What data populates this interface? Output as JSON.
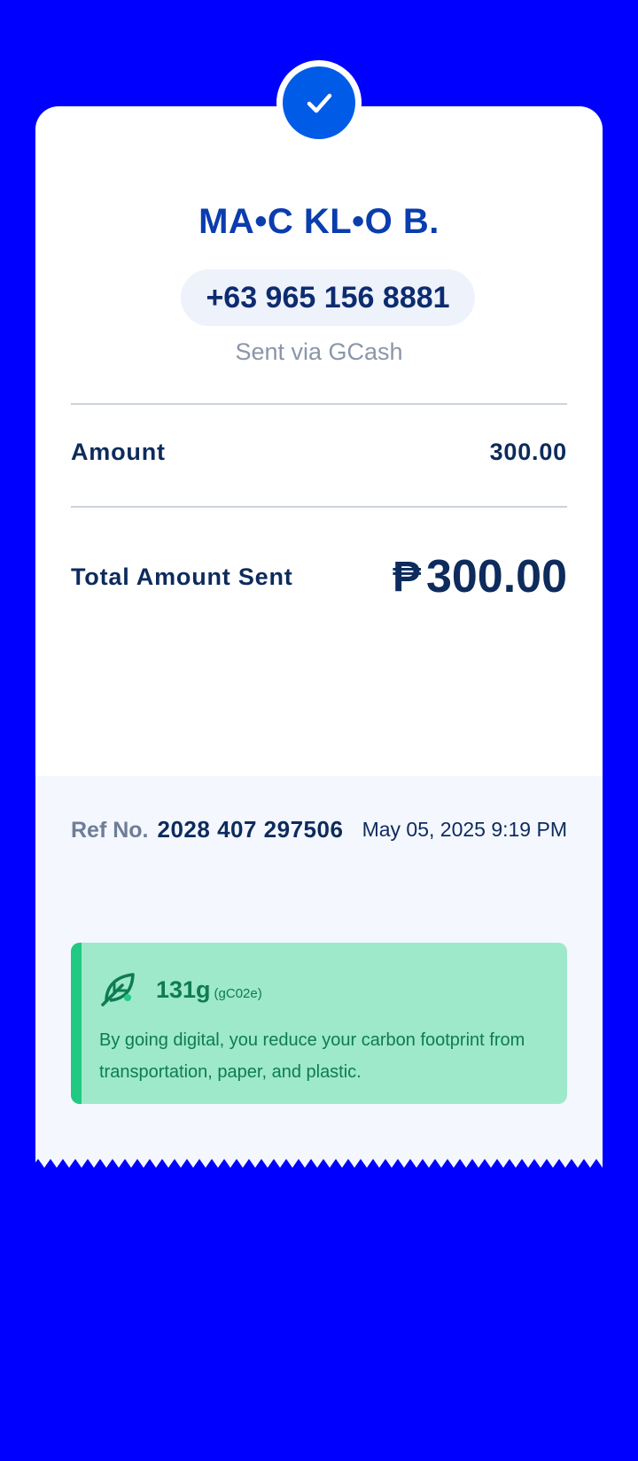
{
  "status": {
    "icon": "checkmark-icon"
  },
  "recipient": {
    "name": "MA•C KL•O B.",
    "phone": "+63 965 156 8881",
    "channel": "Sent via GCash"
  },
  "amount": {
    "label": "Amount",
    "value": "300.00"
  },
  "total": {
    "label": "Total Amount Sent",
    "currency": "₱",
    "value": "300.00"
  },
  "reference": {
    "label": "Ref No.",
    "number": "2028 407 297506",
    "datetime": "May 05, 2025 9:19 PM"
  },
  "eco": {
    "icon": "leaf-icon",
    "amount": "131g",
    "unit": "(gC02e)",
    "message": "By going digital, you reduce your carbon footprint from transportation, paper, and plastic."
  },
  "colors": {
    "background": "#0000FF",
    "accent_blue": "#005CE6",
    "name_blue": "#0A3DAE",
    "text_dark": "#0D2B5C",
    "eco_bg": "#9DE9C9",
    "eco_accent": "#22C983",
    "eco_text": "#0E7B53"
  }
}
